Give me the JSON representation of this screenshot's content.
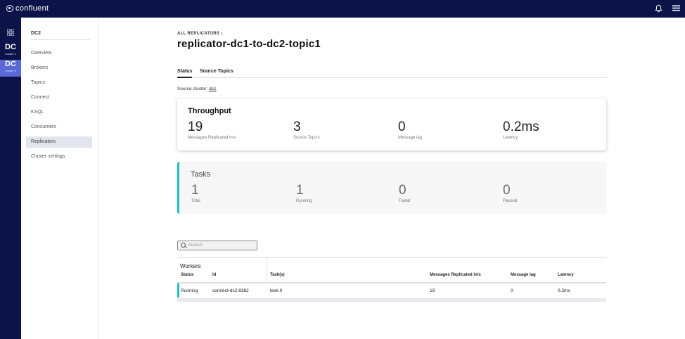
{
  "app": {
    "logo_text": "confluent",
    "bell_icon": "bell-icon",
    "menu_icon": "hamburger-menu-icon"
  },
  "rail": {
    "grid_icon": "grid-icon",
    "clusters": [
      {
        "label": "DC",
        "sub": "Cluster 1"
      },
      {
        "label": "DC",
        "sub": "Cluster 2"
      }
    ]
  },
  "sidenav": {
    "title": "DC2",
    "items": [
      {
        "label": "Overview"
      },
      {
        "label": "Brokers"
      },
      {
        "label": "Topics"
      },
      {
        "label": "Connect"
      },
      {
        "label": "KSQL"
      },
      {
        "label": "Consumers"
      },
      {
        "label": "Replicators"
      },
      {
        "label": "Cluster settings"
      }
    ]
  },
  "main": {
    "breadcrumb": "ALL REPLICATORS ›",
    "title": "replicator-dc1-to-dc2-topic1",
    "tabs": [
      {
        "label": "Status"
      },
      {
        "label": "Source Topics"
      }
    ],
    "source_label": "Source cluster:",
    "source_value": "dc1",
    "throughput": {
      "title": "Throughput",
      "metrics": [
        {
          "value": "19",
          "label": "Messages Replicated in/s"
        },
        {
          "value": "3",
          "label": "Source Topics"
        },
        {
          "value": "0",
          "label": "Message lag"
        },
        {
          "value": "0.2ms",
          "label": "Latency"
        }
      ]
    },
    "tasks": {
      "title": "Tasks",
      "metrics": [
        {
          "value": "1",
          "label": "Total"
        },
        {
          "value": "1",
          "label": "Running"
        },
        {
          "value": "0",
          "label": "Failed"
        },
        {
          "value": "0",
          "label": "Paused"
        }
      ]
    },
    "search": {
      "placeholder": "Search"
    },
    "workers": {
      "caption": "Workers",
      "columns": [
        "Status",
        "Id",
        "Task(s)",
        "Messages Replicated in/s",
        "Message lag",
        "Latency"
      ],
      "rows": [
        {
          "status": "Running",
          "id": "connect-dc2:8382",
          "tasks": "task.0",
          "messages": "19",
          "lag": "0",
          "latency": "0.2ms"
        }
      ]
    },
    "accent_color": "#18c2c0",
    "nav_color": "#0b1348"
  }
}
